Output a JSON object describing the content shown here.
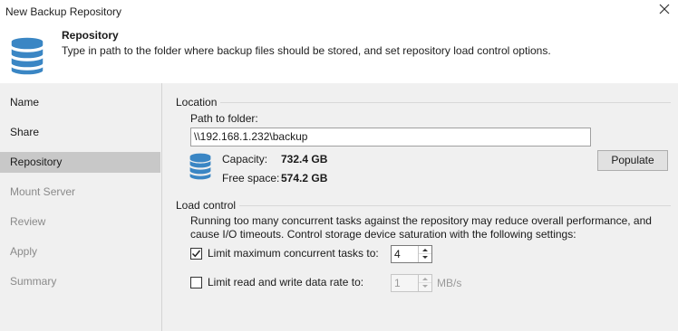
{
  "window": {
    "title": "New Backup Repository",
    "close_icon": "close-icon"
  },
  "header": {
    "icon": "database-icon",
    "title": "Repository",
    "description": "Type in path to the folder where backup files should be stored, and set repository load control options."
  },
  "sidebar": {
    "items": [
      {
        "label": "Name",
        "state": "enabled"
      },
      {
        "label": "Share",
        "state": "enabled"
      },
      {
        "label": "Repository",
        "state": "active"
      },
      {
        "label": "Mount Server",
        "state": "disabled"
      },
      {
        "label": "Review",
        "state": "disabled"
      },
      {
        "label": "Apply",
        "state": "disabled"
      },
      {
        "label": "Summary",
        "state": "disabled"
      }
    ]
  },
  "location": {
    "group_label": "Location",
    "path_label": "Path to folder:",
    "path_value": "\\\\192.168.1.232\\backup",
    "capacity_label": "Capacity:",
    "capacity_value": "732.4 GB",
    "free_label": "Free space:",
    "free_value": "574.2 GB",
    "populate_label": "Populate",
    "storage_icon": "database-icon"
  },
  "load_control": {
    "group_label": "Load control",
    "description": "Running too many concurrent tasks against the repository may reduce overall performance, and cause I/O timeouts. Control storage device saturation with the following settings:",
    "limit_tasks_label": "Limit maximum concurrent tasks to:",
    "limit_tasks_checked": true,
    "limit_tasks_value": "4",
    "limit_rate_label": "Limit read and write data rate to:",
    "limit_rate_checked": false,
    "limit_rate_value": "1",
    "limit_rate_unit": "MB/s"
  },
  "colors": {
    "accent": "#2a7ab8",
    "active_nav": "#c8c8c8",
    "panel_bg": "#f0f0f0"
  }
}
